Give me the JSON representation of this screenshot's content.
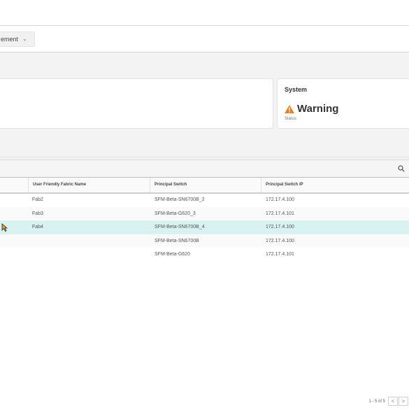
{
  "filter": {
    "dropdown_label": "ement",
    "chevron": "chevron-down-icon"
  },
  "system_card": {
    "title": "System",
    "status": "Warning",
    "status_caption": "Status",
    "icon": "warning-icon"
  },
  "table": {
    "columns": [
      "User Friendly Fabric Name",
      "Principal Switch",
      "Principal Switch IP"
    ],
    "rows": [
      {
        "fabric_name": "Fab2",
        "principal_switch": "SFM-Beta-SN6700B_2",
        "principal_switch_ip": "172.17.4.100"
      },
      {
        "fabric_name": "Fab3",
        "principal_switch": "SFM-Beta-G620_3",
        "principal_switch_ip": "172.17.4.101"
      },
      {
        "fabric_name": "Fab4",
        "principal_switch": "SFM-Beta-SN6700B_4",
        "principal_switch_ip": "172.17.4.100"
      },
      {
        "fabric_name": "",
        "principal_switch": "SFM-Beta-SN6700B",
        "principal_switch_ip": "172.17.4.100"
      },
      {
        "fabric_name": "",
        "principal_switch": "SFM-Beta-G620",
        "principal_switch_ip": "172.17.4.101"
      }
    ],
    "selected_row_index": 2
  },
  "pagination": {
    "info": "1 - 5 of 5",
    "prev": "<",
    "next": ">"
  },
  "colors": {
    "warning": "#e8811a",
    "selected_row": "#d8f1f1"
  }
}
